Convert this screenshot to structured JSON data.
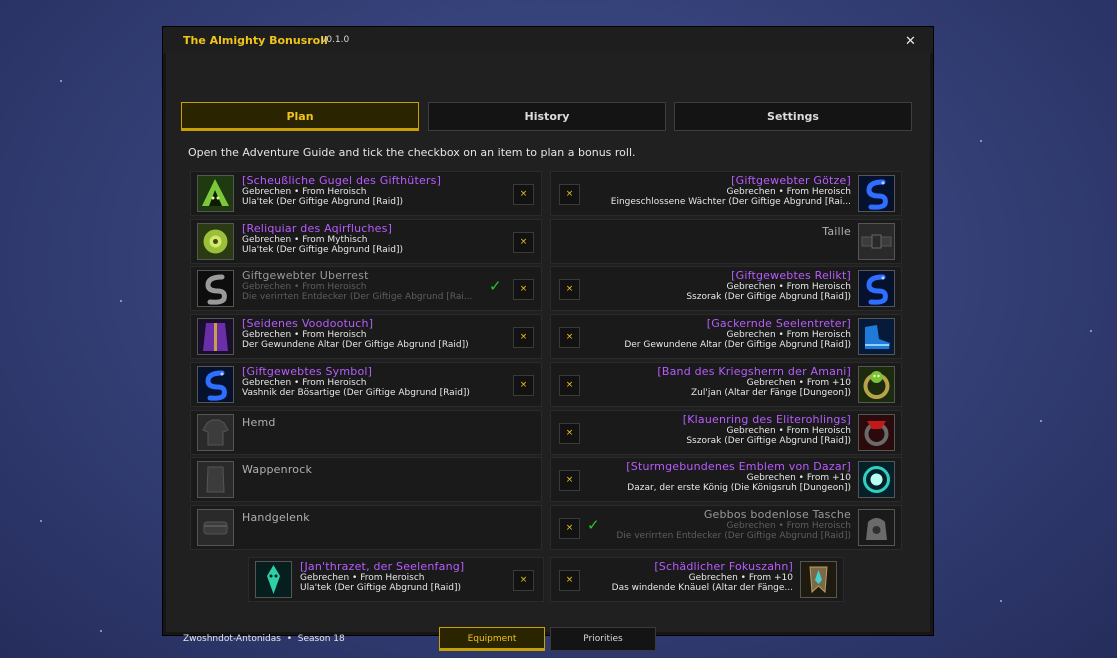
{
  "window": {
    "title": "The Almighty Bonusroll",
    "version": "v0.1.0",
    "close_glyph": "✕"
  },
  "tabs": [
    {
      "label": "Plan"
    },
    {
      "label": "History"
    },
    {
      "label": "Settings"
    }
  ],
  "instruction": "Open the Adventure Guide and tick the checkbox on an item to plan a bonus roll.",
  "checkbox_glyph": "×",
  "tick_glyph": "✓",
  "left_slots": [
    {
      "name": "[Scheußliche Gugel des Gifthüters]",
      "line2": "Gebrechen  •  From Heroisch",
      "line3": "Ula'tek (Der Giftige Abgrund [Raid])",
      "icon": "hood-icon"
    },
    {
      "name": "[Reliquiar des Aqirfluches]",
      "line2": "Gebrechen  •  From Mythisch",
      "line3": "Ula'tek (Der Giftige Abgrund [Raid])",
      "icon": "reliquary-icon"
    },
    {
      "name": "Giftgewebter Überrest",
      "line2": "Gebrechen  •  From Heroisch",
      "line3": "Die verirrten Entdecker (Der Giftige Abgrund [Rai...",
      "icon": "serpent-dark-icon",
      "dim": true,
      "tick": true
    },
    {
      "name": "[Seidenes Voodootuch]",
      "line2": "Gebrechen  •  From Heroisch",
      "line3": "Der Gewundene Altar (Der Giftige Abgrund [Raid])",
      "icon": "cloak-icon"
    },
    {
      "name": "[Giftgewebtes Symbol]",
      "line2": "Gebrechen  •  From Heroisch",
      "line3": "Vashnik der Bösartige (Der Giftige Abgrund [Raid])",
      "icon": "serpent-blue-icon"
    },
    {
      "name": "Hemd",
      "icon": "shirt-slot-icon",
      "empty": true
    },
    {
      "name": "Wappenrock",
      "icon": "tabard-slot-icon",
      "empty": true
    },
    {
      "name": "Handgelenk",
      "icon": "wrist-slot-icon",
      "empty": true
    }
  ],
  "right_slots": [
    {
      "name": "[Giftgewebter Götze]",
      "line2": "Gebrechen  •  From Heroisch",
      "line3": "Eingeschlossene Wächter (Der Giftige Abgrund [Rai...",
      "icon": "serpent-blue-icon"
    },
    {
      "name": "Taille",
      "icon": "waist-slot-icon",
      "empty": true
    },
    {
      "name": "[Giftgewebtes Relikt]",
      "line2": "Gebrechen  •  From Heroisch",
      "line3": "Sszorak (Der Giftige Abgrund [Raid])",
      "icon": "serpent-blue-icon"
    },
    {
      "name": "[Gackernde Seelentreter]",
      "line2": "Gebrechen  •  From Heroisch",
      "line3": "Der Gewundene Altar (Der Giftige Abgrund [Raid])",
      "icon": "boots-icon"
    },
    {
      "name": "[Band des Kriegsherrn der Amani]",
      "line2": "Gebrechen  •  From +10",
      "line3": "Zul'jan (Altar der Fänge [Dungeon])",
      "icon": "ring-green-icon"
    },
    {
      "name": "[Klauenring des Eliterohlings]",
      "line2": "Gebrechen  •  From Heroisch",
      "line3": "Sszorak (Der Giftige Abgrund [Raid])",
      "icon": "ring-red-icon"
    },
    {
      "name": "[Sturmgebundenes Emblem von Dazar]",
      "line2": "Gebrechen  •  From +10",
      "line3": "Dazar, der erste König (Die Königsruh [Dungeon])",
      "icon": "emblem-icon"
    },
    {
      "name": "Gebbos bodenlose Tasche",
      "line2": "Gebrechen  •  From Heroisch",
      "line3": "Die verirrten Entdecker (Der Giftige Abgrund [Raid])",
      "icon": "bag-icon",
      "dim": true,
      "tick": true
    }
  ],
  "weapon_slots": [
    {
      "name": "[Jan'thrazet, der Seelenfang]",
      "line2": "Gebrechen  •  From Heroisch",
      "line3": "Ula'tek (Der Giftige Abgrund [Raid])",
      "icon": "skull-blade-icon"
    },
    {
      "name": "[Schädlicher Fokuszahn]",
      "line2": "Gebrechen  •  From +10",
      "line3": "Das windende Knäuel (Altar der Fänge...",
      "icon": "fang-icon"
    }
  ],
  "footer": {
    "character": "Zwoshndot-Antonidas",
    "separator": "•",
    "season": "Season 18",
    "tabs": [
      {
        "label": "Equipment"
      },
      {
        "label": "Priorities"
      }
    ]
  },
  "colors": {
    "accent": "#f0c419",
    "epic": "#b85cff",
    "tick": "#25c825"
  }
}
